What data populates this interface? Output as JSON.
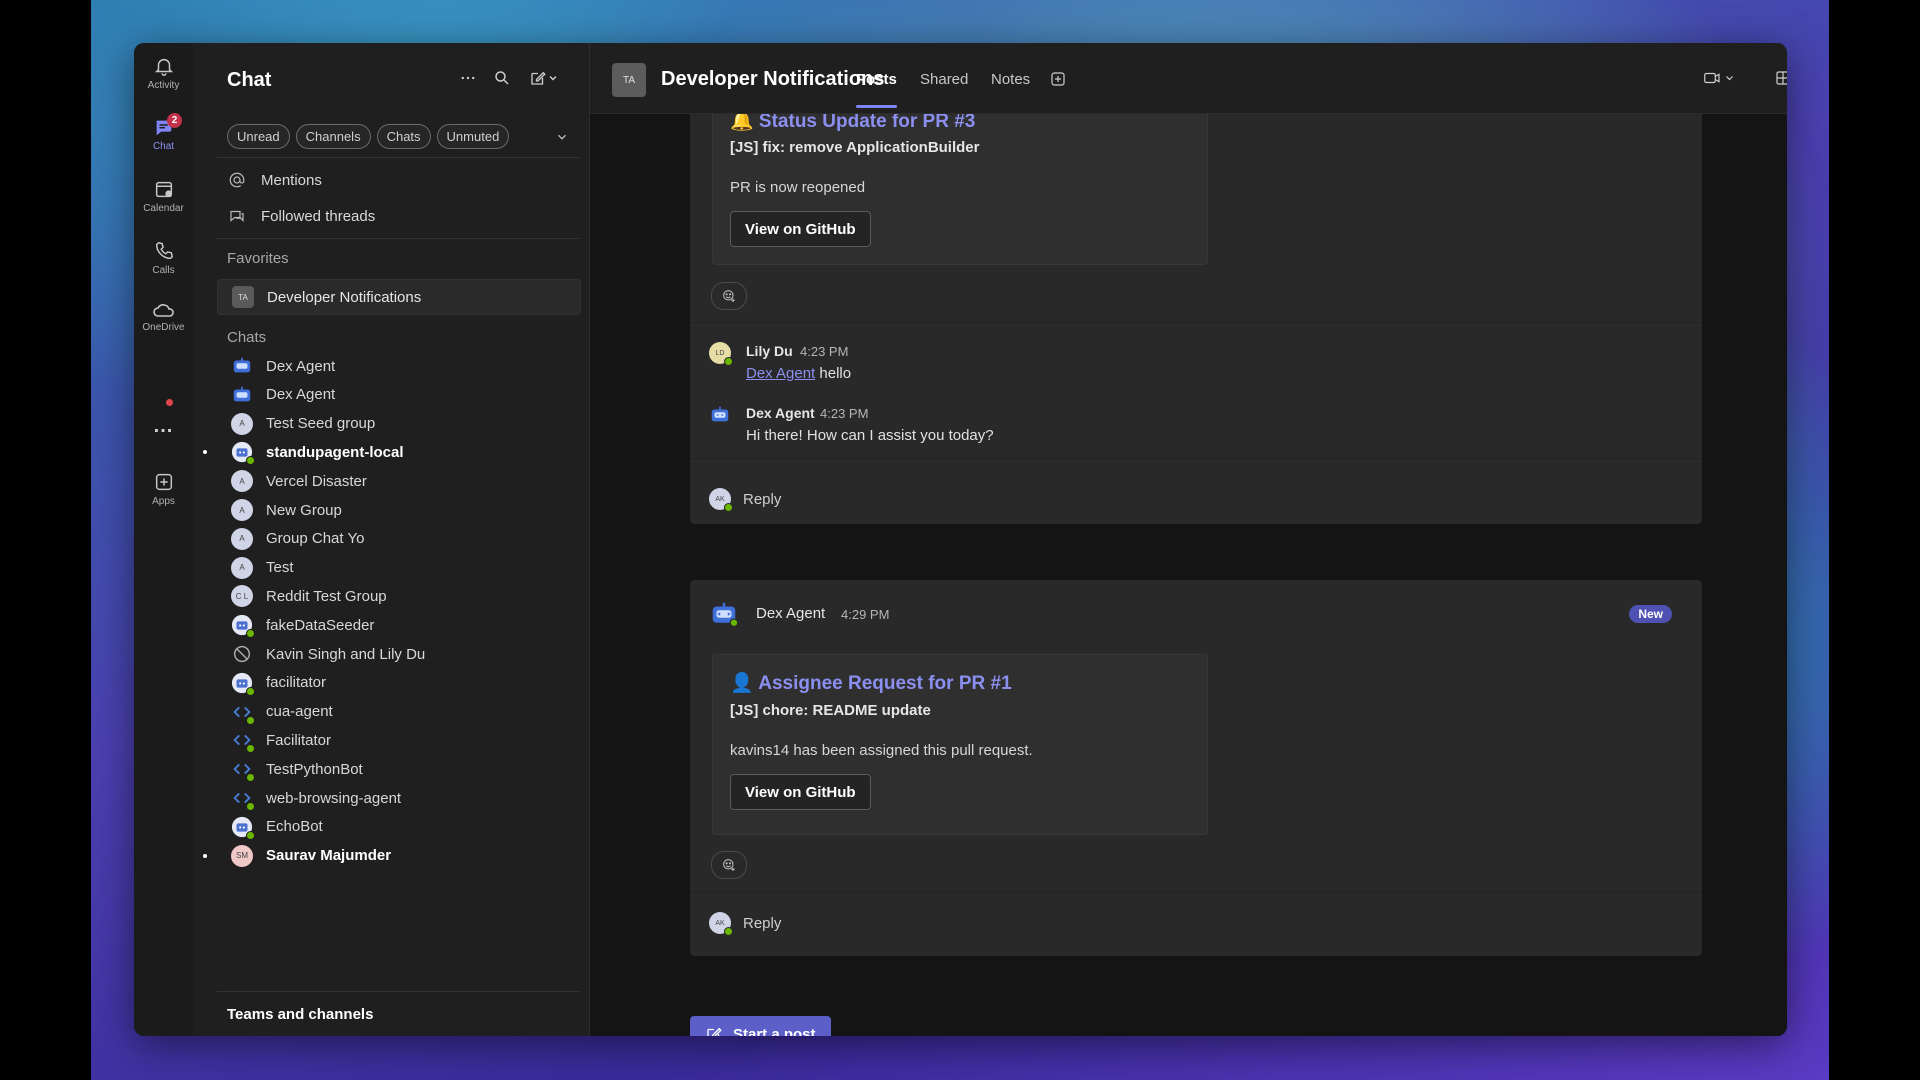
{
  "rail": {
    "items": [
      {
        "label": "Activity",
        "icon": "bell-icon"
      },
      {
        "label": "Chat",
        "icon": "chat-icon",
        "badge": "2"
      },
      {
        "label": "Calendar",
        "icon": "calendar-icon"
      },
      {
        "label": "Calls",
        "icon": "phone-icon"
      },
      {
        "label": "OneDrive",
        "icon": "cloud-icon"
      },
      {
        "label": "Apps",
        "icon": "plus-box-icon"
      }
    ],
    "more_label": "..."
  },
  "chat_pane": {
    "title": "Chat",
    "filters": [
      "Unread",
      "Channels",
      "Chats",
      "Unmuted"
    ],
    "nav": [
      "Mentions",
      "Followed threads"
    ],
    "favorites_header": "Favorites",
    "favorites": [
      {
        "label": "Developer Notifications",
        "initials": "TA"
      }
    ],
    "chats_header": "Chats",
    "chats": [
      {
        "label": "Dex Agent",
        "avatar": "bot"
      },
      {
        "label": "Dex Agent",
        "avatar": "bot"
      },
      {
        "label": "Test Seed group",
        "avatar": "group",
        "initials": "A"
      },
      {
        "label": "standupagent-local",
        "avatar": "bot2",
        "bold": true,
        "unread": true
      },
      {
        "label": "Vercel Disaster",
        "avatar": "group",
        "initials": "A"
      },
      {
        "label": "New Group",
        "avatar": "group",
        "initials": "A"
      },
      {
        "label": "Group Chat Yo",
        "avatar": "group",
        "initials": "A"
      },
      {
        "label": "Test",
        "avatar": "group",
        "initials": "A"
      },
      {
        "label": "Reddit Test Group",
        "avatar": "group",
        "initials": "C L"
      },
      {
        "label": "fakeDataSeeder",
        "avatar": "bot2"
      },
      {
        "label": "Kavin Singh and Lily Du",
        "avatar": "muted"
      },
      {
        "label": "facilitator",
        "avatar": "bot2"
      },
      {
        "label": "cua-agent",
        "avatar": "code"
      },
      {
        "label": "Facilitator",
        "avatar": "code"
      },
      {
        "label": "TestPythonBot",
        "avatar": "code"
      },
      {
        "label": "web-browsing-agent",
        "avatar": "code"
      },
      {
        "label": "EchoBot",
        "avatar": "bot2"
      },
      {
        "label": "Saurav Majumder",
        "avatar": "person",
        "initials": "SM",
        "bold": true,
        "unread": true
      }
    ],
    "teams_header": "Teams and channels"
  },
  "header": {
    "channel_initials": "TA",
    "channel_title": "Developer Notifications",
    "tabs": [
      "Posts",
      "Shared",
      "Notes"
    ],
    "active_tab": "Posts"
  },
  "posts": [
    {
      "card_title": "🔔 Status Update for PR #3",
      "card_subtitle": "[JS] fix: remove ApplicationBuilder",
      "card_body": "PR is now reopened",
      "button_label": "View on GitHub",
      "replies": [
        {
          "name": "Lily Du",
          "time": "4:23 PM",
          "mention": "Dex Agent",
          "text": " hello",
          "initials": "LD"
        },
        {
          "name": "Dex Agent",
          "time": "4:23 PM",
          "text": "Hi there! How can I assist you today?"
        }
      ],
      "reply_label": "Reply"
    },
    {
      "author": "Dex Agent",
      "time": "4:29 PM",
      "badge": "New",
      "card_title": "👤 Assignee Request for PR #1",
      "card_subtitle": "[JS] chore: README update",
      "card_body": "kavins14 has been assigned this pull request.",
      "button_label": "View on GitHub",
      "reply_label": "Reply"
    }
  ],
  "start_post_label": "Start a post",
  "colors": {
    "accent": "#5b5fc7",
    "link": "#8b8ff0",
    "badge": "#c4314b",
    "online": "#6bb700"
  }
}
